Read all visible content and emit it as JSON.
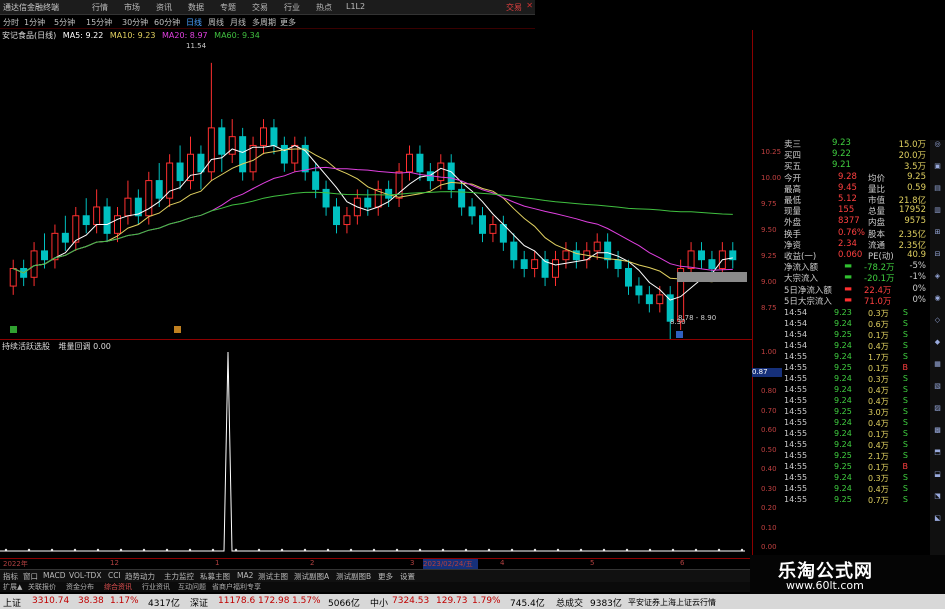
{
  "titlebar": {
    "app_title": "通达信金融终端",
    "menu": [
      "行情",
      "市场",
      "资讯",
      "数据",
      "专题",
      "交易",
      "行业",
      "热点",
      "L1L2"
    ],
    "trade_label": "交易",
    "close": "✕"
  },
  "periods": [
    "分时",
    "1分钟",
    "5分钟",
    "15分钟",
    "30分钟",
    "60分钟",
    "日线",
    "周线",
    "月线",
    "多周期",
    "更多"
  ],
  "selected_period": "日线",
  "stock_title": "安记食品(日线)",
  "ma_legend": [
    {
      "label": "MA5: 9.22",
      "color": "#ffffff"
    },
    {
      "label": "MA10: 9.23",
      "color": "#e0d060"
    },
    {
      "label": "MA20: 8.97",
      "color": "#e040e0"
    },
    {
      "label": "MA60: 9.34",
      "color": "#40c040"
    }
  ],
  "chart_data": {
    "type": "candlestick",
    "high_label": "11.54",
    "low_label": "8.30",
    "range_label": "8.78 - 8.90",
    "ylim": [
      8.5,
      11.8
    ],
    "y_ticks": [
      "10.25",
      "10.00",
      "9.75",
      "9.50",
      "9.25",
      "9.00",
      "8.75"
    ],
    "candles": [
      [
        9.0,
        9.2,
        9.3,
        8.9
      ],
      [
        9.2,
        9.1,
        9.3,
        9.0
      ],
      [
        9.1,
        9.4,
        9.5,
        9.0
      ],
      [
        9.4,
        9.3,
        9.6,
        9.2
      ],
      [
        9.3,
        9.6,
        9.7,
        9.2
      ],
      [
        9.6,
        9.5,
        9.8,
        9.4
      ],
      [
        9.5,
        9.8,
        9.9,
        9.4
      ],
      [
        9.8,
        9.7,
        10.0,
        9.6
      ],
      [
        9.7,
        9.9,
        10.1,
        9.6
      ],
      [
        9.9,
        9.6,
        10.0,
        9.5
      ],
      [
        9.6,
        9.8,
        9.9,
        9.5
      ],
      [
        9.8,
        10.0,
        10.2,
        9.7
      ],
      [
        10.0,
        9.8,
        10.1,
        9.7
      ],
      [
        9.8,
        10.2,
        10.3,
        9.7
      ],
      [
        10.2,
        10.0,
        10.4,
        9.9
      ],
      [
        10.0,
        10.4,
        10.5,
        9.9
      ],
      [
        10.4,
        10.2,
        10.6,
        10.1
      ],
      [
        10.2,
        10.5,
        10.7,
        10.1
      ],
      [
        10.5,
        10.3,
        10.6,
        10.1
      ],
      [
        10.3,
        10.8,
        11.54,
        10.2
      ],
      [
        10.8,
        10.5,
        10.9,
        10.3
      ],
      [
        10.5,
        10.7,
        10.9,
        10.4
      ],
      [
        10.7,
        10.3,
        10.8,
        10.2
      ],
      [
        10.3,
        10.6,
        10.7,
        10.2
      ],
      [
        10.6,
        10.8,
        10.9,
        10.5
      ],
      [
        10.8,
        10.6,
        10.9,
        10.5
      ],
      [
        10.6,
        10.4,
        10.7,
        10.3
      ],
      [
        10.4,
        10.6,
        10.7,
        10.3
      ],
      [
        10.6,
        10.3,
        10.7,
        10.2
      ],
      [
        10.3,
        10.1,
        10.4,
        10.0
      ],
      [
        10.1,
        9.9,
        10.2,
        9.8
      ],
      [
        9.9,
        9.7,
        10.0,
        9.6
      ],
      [
        9.7,
        9.8,
        9.9,
        9.6
      ],
      [
        9.8,
        10.0,
        10.1,
        9.7
      ],
      [
        10.0,
        9.9,
        10.1,
        9.8
      ],
      [
        9.9,
        10.1,
        10.2,
        9.8
      ],
      [
        10.1,
        10.0,
        10.2,
        9.9
      ],
      [
        10.0,
        10.3,
        10.4,
        9.9
      ],
      [
        10.3,
        10.5,
        10.6,
        10.2
      ],
      [
        10.5,
        10.3,
        10.6,
        10.2
      ],
      [
        10.3,
        10.2,
        10.4,
        10.1
      ],
      [
        10.2,
        10.4,
        10.5,
        10.1
      ],
      [
        10.4,
        10.1,
        10.5,
        10.0
      ],
      [
        10.1,
        9.9,
        10.2,
        9.8
      ],
      [
        9.9,
        9.8,
        10.0,
        9.7
      ],
      [
        9.8,
        9.6,
        9.9,
        9.5
      ],
      [
        9.6,
        9.7,
        9.8,
        9.5
      ],
      [
        9.7,
        9.5,
        9.8,
        9.4
      ],
      [
        9.5,
        9.3,
        9.6,
        9.2
      ],
      [
        9.3,
        9.2,
        9.4,
        9.1
      ],
      [
        9.2,
        9.3,
        9.4,
        9.1
      ],
      [
        9.3,
        9.1,
        9.4,
        9.0
      ],
      [
        9.1,
        9.3,
        9.4,
        9.0
      ],
      [
        9.3,
        9.4,
        9.5,
        9.2
      ],
      [
        9.4,
        9.3,
        9.5,
        9.2
      ],
      [
        9.3,
        9.4,
        9.5,
        9.2
      ],
      [
        9.4,
        9.5,
        9.6,
        9.3
      ],
      [
        9.5,
        9.3,
        9.6,
        9.2
      ],
      [
        9.3,
        9.2,
        9.4,
        9.1
      ],
      [
        9.2,
        9.0,
        9.3,
        8.9
      ],
      [
        9.0,
        8.9,
        9.1,
        8.8
      ],
      [
        8.9,
        8.8,
        9.0,
        8.7
      ],
      [
        8.8,
        8.9,
        9.0,
        8.7
      ],
      [
        8.9,
        8.6,
        9.0,
        8.3
      ],
      [
        8.6,
        9.2,
        9.3,
        8.5
      ],
      [
        9.2,
        9.4,
        9.5,
        9.1
      ],
      [
        9.4,
        9.3,
        9.5,
        9.2
      ],
      [
        9.3,
        9.2,
        9.4,
        9.1
      ],
      [
        9.2,
        9.4,
        9.5,
        9.1
      ],
      [
        9.4,
        9.3,
        9.5,
        9.2
      ]
    ]
  },
  "indicator": {
    "name": "持续活跃选股",
    "value_label": "堆量回调 0.00",
    "y_ticks": [
      "1.00",
      "0.90",
      "0.80",
      "0.70",
      "0.60",
      "0.50",
      "0.40",
      "0.30",
      "0.20",
      "0.10",
      "0.00"
    ],
    "cursor_value": "0.87",
    "signal_index": 30
  },
  "datebar": {
    "year": "2022年",
    "marks": [
      "12",
      "1",
      "2",
      "3",
      "4",
      "5",
      "6"
    ],
    "highlight": "2023/02/24/五"
  },
  "tabs": [
    "指标",
    "窗口",
    "MACD",
    "VOL-TDX",
    "CCI",
    "趋势动力",
    "主力监控",
    "私募主图",
    "MA2",
    "测试主图",
    "测试副图A",
    "测试副图B",
    "更多",
    "设置"
  ],
  "tabs2": [
    "扩展▲",
    "关联报价",
    "资金分布",
    "综合资讯",
    "行业资讯",
    "互动问题",
    "省商户福利专享"
  ],
  "statusbar": {
    "sh_label": "上证",
    "sh_val": "3310.74",
    "sh_chg": "38.38",
    "sh_pct": "1.17%",
    "sh_amt": "4317亿",
    "sz_label": "深证",
    "sz_val": "11178.6",
    "sz_chg": "172.98",
    "sz_pct": "1.57%",
    "sz_amt": "5066亿",
    "zx_label": "中小",
    "zx_val": "7324.53",
    "zx_chg": "129.73",
    "zx_pct": "1.79%",
    "zx_amt": "745.4亿",
    "total_label": "总成交",
    "total_val": "9383亿",
    "broker": "平安证券上海上证云行情"
  },
  "quote": {
    "ask": [
      {
        "label": "卖三",
        "price": "9.23",
        "vol": "15.0万"
      },
      {
        "label": "买四",
        "price": "9.22",
        "vol": "20.0万"
      },
      {
        "label": "买五",
        "price": "9.21",
        "vol": "3.5万"
      }
    ],
    "stats": [
      {
        "l1": "今开",
        "v1": "9.28",
        "l2": "均价",
        "v2": "9.25"
      },
      {
        "l1": "最高",
        "v1": "9.45",
        "l2": "量比",
        "v2": "0.59"
      },
      {
        "l1": "最低",
        "v1": "5.12",
        "l2": "市值",
        "v2": "21.8亿"
      },
      {
        "l1": "现量",
        "v1": "155",
        "l2": "总量",
        "v2": "17952"
      },
      {
        "l1": "外盘",
        "v1": "8377",
        "l2": "内盘",
        "v2": "9575"
      },
      {
        "l1": "换手",
        "v1": "0.76%",
        "l2": "股本",
        "v2": "2.35亿"
      },
      {
        "l1": "净资",
        "v1": "2.34",
        "l2": "流通",
        "v2": "2.35亿"
      },
      {
        "l1": "收益(一)",
        "v1": "0.060",
        "l2": "PE(动)",
        "v2": "40.9"
      }
    ],
    "flows": [
      {
        "label": "净流入额",
        "val": "-78.2万",
        "pct": "-5%"
      },
      {
        "label": "大宗流入",
        "val": "-20.1万",
        "pct": "-1%"
      },
      {
        "label": "5日净流入额",
        "val": "22.4万",
        "pct": "0%"
      },
      {
        "label": "5日大宗流入",
        "val": "71.0万",
        "pct": "0%"
      }
    ],
    "ticks": [
      {
        "t": "14:54",
        "p": "9.23",
        "v": "0.3万",
        "s": "S"
      },
      {
        "t": "14:54",
        "p": "9.24",
        "v": "0.6万",
        "s": "S"
      },
      {
        "t": "14:54",
        "p": "9.25",
        "v": "0.1万",
        "s": "S"
      },
      {
        "t": "14:54",
        "p": "9.24",
        "v": "0.4万",
        "s": "S"
      },
      {
        "t": "14:55",
        "p": "9.24",
        "v": "1.7万",
        "s": "S"
      },
      {
        "t": "14:55",
        "p": "9.25",
        "v": "0.1万",
        "s": "B"
      },
      {
        "t": "14:55",
        "p": "9.24",
        "v": "0.3万",
        "s": "S"
      },
      {
        "t": "14:55",
        "p": "9.24",
        "v": "0.4万",
        "s": "S"
      },
      {
        "t": "14:55",
        "p": "9.24",
        "v": "0.4万",
        "s": "S"
      },
      {
        "t": "14:55",
        "p": "9.25",
        "v": "3.0万",
        "s": "S"
      },
      {
        "t": "14:55",
        "p": "9.24",
        "v": "0.4万",
        "s": "S"
      },
      {
        "t": "14:55",
        "p": "9.24",
        "v": "0.1万",
        "s": "S"
      },
      {
        "t": "14:55",
        "p": "9.24",
        "v": "0.4万",
        "s": "S"
      },
      {
        "t": "14:55",
        "p": "9.25",
        "v": "2.1万",
        "s": "S"
      },
      {
        "t": "14:55",
        "p": "9.25",
        "v": "0.1万",
        "s": "B"
      },
      {
        "t": "14:55",
        "p": "9.24",
        "v": "0.3万",
        "s": "S"
      },
      {
        "t": "14:55",
        "p": "9.24",
        "v": "0.4万",
        "s": "S"
      },
      {
        "t": "14:55",
        "p": "9.25",
        "v": "0.7万",
        "s": "S"
      }
    ]
  },
  "watermark": {
    "line1": "乐淘公式网",
    "line2": "www.60lt.com"
  },
  "right_icons": [
    "◎",
    "▣",
    "▤",
    "▥",
    "⊞",
    "⊟",
    "◈",
    "◉",
    "◇",
    "◆",
    "▦",
    "▧",
    "▨",
    "▩",
    "⬒",
    "⬓",
    "⬔",
    "⬕"
  ],
  "colors": {
    "up": "#ff3030",
    "down": "#00c0c0",
    "ma5": "#ffffff",
    "ma10": "#e0d060",
    "ma20": "#e040e0",
    "ma60": "#40c040",
    "axis": "#8b0000"
  }
}
